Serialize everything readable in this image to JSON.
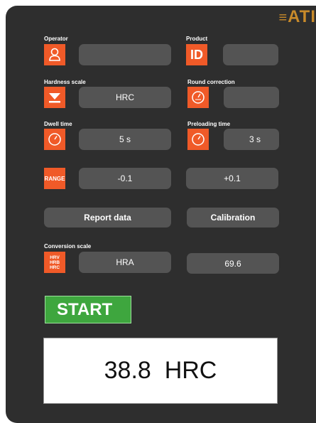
{
  "brand": {
    "logo_text": "ATI"
  },
  "operator": {
    "label": "Operator",
    "value": ""
  },
  "product": {
    "label": "Product",
    "icon_text": "ID",
    "value": ""
  },
  "hardness_scale": {
    "label": "Hardness scale",
    "value": "HRC"
  },
  "round_correction": {
    "label": "Round correction",
    "value": ""
  },
  "dwell_time": {
    "label": "Dwell time",
    "value": "5 s"
  },
  "preloading_time": {
    "label": "Preloading time",
    "value": "3 s"
  },
  "range": {
    "icon_text": "RANGE",
    "low": "-0.1",
    "high": "+0.1"
  },
  "buttons": {
    "report_data": "Report data",
    "calibration": "Calibration",
    "start": "START"
  },
  "conversion_scale": {
    "label": "Conversion scale",
    "icon_lines": [
      "HRV",
      "HRB",
      "HRC"
    ],
    "value": "HRA",
    "converted_value": "69.6"
  },
  "result": {
    "display": "38.8  HRC"
  },
  "colors": {
    "accent": "#f05a28",
    "panel": "#2e2e2e",
    "field": "#545454",
    "start": "#3ea63e",
    "logo": "#c88a2a"
  }
}
